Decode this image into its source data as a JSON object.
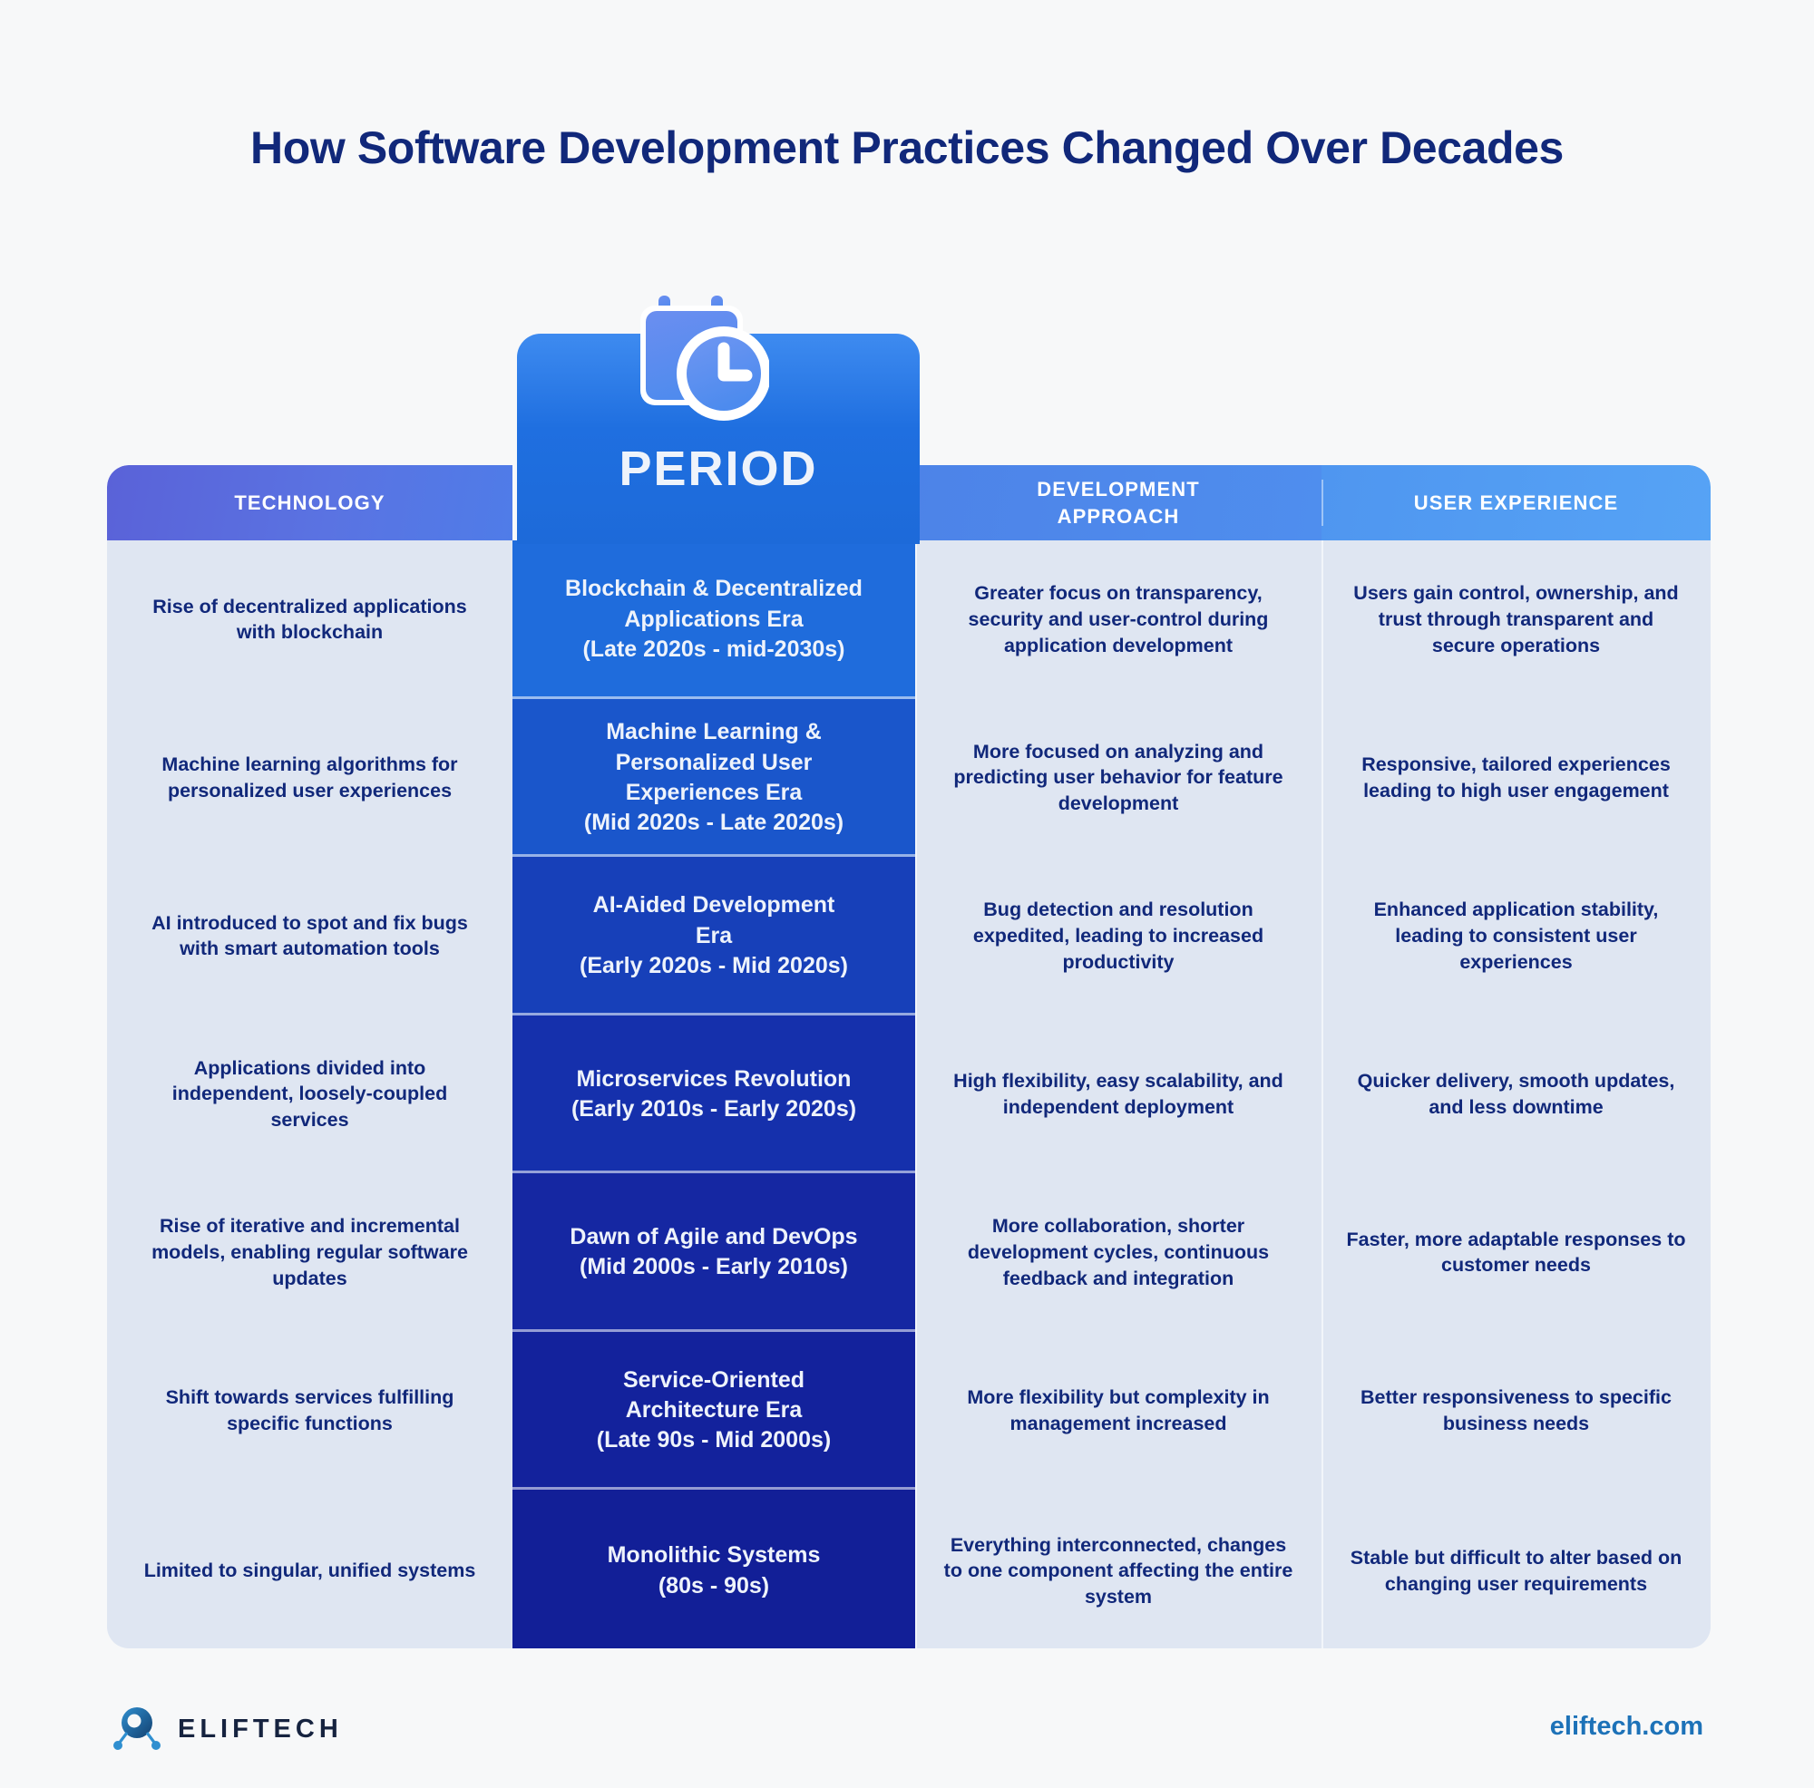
{
  "title": "How Software Development Practices Changed Over Decades",
  "spotlight": {
    "label": "PERIOD",
    "icon": "calendar-clock-icon"
  },
  "table": {
    "headers": {
      "technology": "TECHNOLOGY",
      "period": "PERIOD",
      "development_approach_line1": "DEVELOPMENT",
      "development_approach_line2": "APPROACH",
      "user_experience": "USER EXPERIENCE"
    },
    "rows": [
      {
        "technology": "Rise of decentralized applications with blockchain",
        "period_name_l1": "Blockchain & Decentralized",
        "period_name_l2": "Applications Era",
        "period_range": "(Late 2020s - mid-2030s)",
        "development_approach": "Greater focus on transparency, security and user-control during application development",
        "user_experience": "Users gain control, ownership, and trust through transparent and secure operations"
      },
      {
        "technology": "Machine learning algorithms for personalized user experiences",
        "period_name_l1": "Machine Learning &",
        "period_name_l2": "Personalized User",
        "period_name_l3": "Experiences Era",
        "period_range": "(Mid 2020s - Late 2020s)",
        "development_approach": "More focused on analyzing and predicting user behavior for feature development",
        "user_experience": "Responsive, tailored experiences leading to high user engagement"
      },
      {
        "technology": "AI introduced to spot and fix bugs with smart automation tools",
        "period_name_l1": "AI-Aided Development",
        "period_name_l2": "Era",
        "period_range": "(Early 2020s - Mid 2020s)",
        "development_approach": "Bug detection and resolution expedited, leading to increased productivity",
        "user_experience": "Enhanced application stability, leading to consistent user experiences"
      },
      {
        "technology": "Applications divided into independent, loosely-coupled services",
        "period_name_l1": "Microservices Revolution",
        "period_range": "(Early 2010s - Early 2020s)",
        "development_approach": "High flexibility, easy scalability, and independent deployment",
        "user_experience": "Quicker delivery, smooth updates, and less downtime"
      },
      {
        "technology": "Rise of iterative and incremental models, enabling regular software updates",
        "period_name_l1": "Dawn of Agile and DevOps",
        "period_range": "(Mid 2000s - Early 2010s)",
        "development_approach": "More collaboration, shorter development cycles, continuous feedback and integration",
        "user_experience": "Faster, more adaptable responses to customer needs"
      },
      {
        "technology": "Shift towards services fulfilling specific functions",
        "period_name_l1": "Service-Oriented",
        "period_name_l2": "Architecture Era",
        "period_range": "(Late 90s - Mid 2000s)",
        "development_approach": "More flexibility but complexity in management increased",
        "user_experience": "Better responsiveness to specific business needs"
      },
      {
        "technology": "Limited to singular, unified systems",
        "period_name_l1": "Monolithic Systems",
        "period_range": "(80s - 90s)",
        "development_approach": "Everything interconnected, changes to one component affecting the entire system",
        "user_experience": "Stable but difficult to alter based on changing user requirements"
      }
    ]
  },
  "footer": {
    "brand": "ELIFTECH",
    "url": "eliftech.com",
    "logo_icon": "eliftech-node-logo-icon"
  },
  "colors": {
    "background": "#f7f8f9",
    "title": "#11287a",
    "body_text": "#11287a",
    "cell_bg": "#dfe6f2",
    "header_technology": "#5a62d8",
    "header_development": "#4d83e8",
    "header_user_experience": "#52a0f3",
    "period_top": "#1f6cdc",
    "period_bottom": "#121f97",
    "footer_url": "#1d72b8"
  }
}
